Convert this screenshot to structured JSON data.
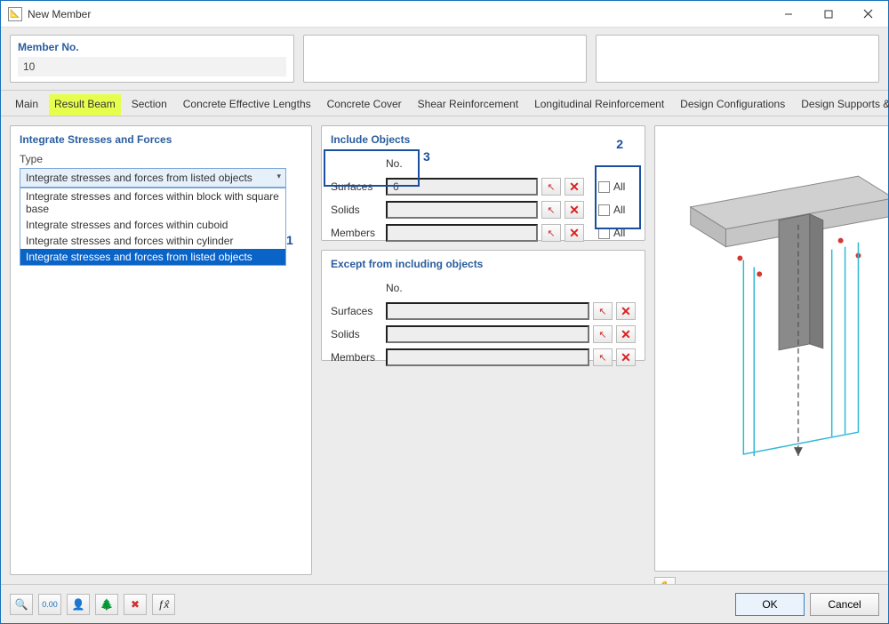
{
  "window": {
    "title": "New Member"
  },
  "header": {
    "member_no_label": "Member No.",
    "member_no_value": "10"
  },
  "tabs": [
    {
      "label": "Main"
    },
    {
      "label": "Result Beam"
    },
    {
      "label": "Section"
    },
    {
      "label": "Concrete Effective Lengths"
    },
    {
      "label": "Concrete Cover"
    },
    {
      "label": "Shear Reinforcement"
    },
    {
      "label": "Longitudinal Reinforcement"
    },
    {
      "label": "Design Configurations"
    },
    {
      "label": "Design Supports & Deflection"
    }
  ],
  "integrate": {
    "title": "Integrate Stresses and Forces",
    "type_label": "Type",
    "selected": "Integrate stresses and forces from listed objects",
    "options": [
      "Integrate stresses and forces within block with square base",
      "Integrate stresses and forces within cuboid",
      "Integrate stresses and forces within cylinder",
      "Integrate stresses and forces from listed objects"
    ]
  },
  "include": {
    "title": "Include Objects",
    "no_header": "No.",
    "rows": [
      {
        "label": "Surfaces",
        "value": "6"
      },
      {
        "label": "Solids",
        "value": ""
      },
      {
        "label": "Members",
        "value": ""
      }
    ],
    "all_label": "All"
  },
  "except": {
    "title": "Except from including objects",
    "no_header": "No.",
    "rows": [
      {
        "label": "Surfaces",
        "value": ""
      },
      {
        "label": "Solids",
        "value": ""
      },
      {
        "label": "Members",
        "value": ""
      }
    ]
  },
  "annotations": {
    "one": "1",
    "two": "2",
    "three": "3"
  },
  "buttons": {
    "ok": "OK",
    "cancel": "Cancel"
  },
  "toolbar_icons": {
    "help": "🔍",
    "units": "0.00",
    "view": "👤",
    "tree": "🌲",
    "unpick": "✖",
    "fx": "ƒx̂"
  }
}
